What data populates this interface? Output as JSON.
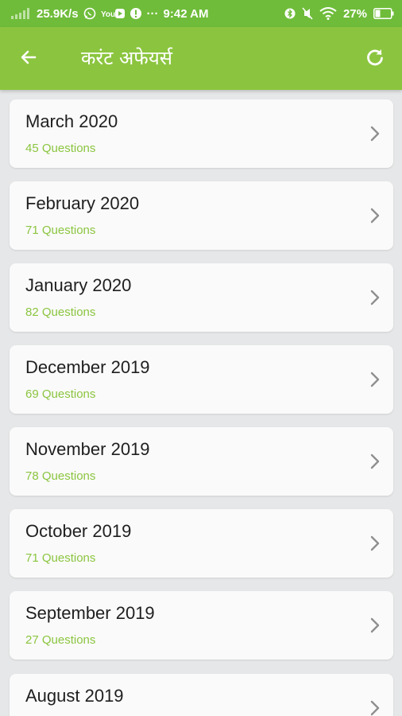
{
  "status_bar": {
    "speed": "25.9K/s",
    "time": "9:42 AM",
    "battery": "27%",
    "dots": "···",
    "yt_label": "You"
  },
  "app_bar": {
    "title": "करंट अफेयर्स",
    "back_icon": "arrow-back-icon",
    "refresh_icon": "refresh-icon",
    "background": "#8bc53f"
  },
  "items": [
    {
      "title": "March 2020",
      "subtitle": "45 Questions"
    },
    {
      "title": "February 2020",
      "subtitle": "71 Questions"
    },
    {
      "title": "January 2020",
      "subtitle": "82 Questions"
    },
    {
      "title": "December 2019",
      "subtitle": "69 Questions"
    },
    {
      "title": "November 2019",
      "subtitle": "78 Questions"
    },
    {
      "title": "October 2019",
      "subtitle": "71 Questions"
    },
    {
      "title": "September 2019",
      "subtitle": "27 Questions"
    },
    {
      "title": "August 2019",
      "subtitle": ""
    }
  ],
  "colors": {
    "status_bar": "#6fbc3a",
    "accent": "#8bc53f",
    "card": "#fafafa",
    "background": "#e6e7e8"
  }
}
